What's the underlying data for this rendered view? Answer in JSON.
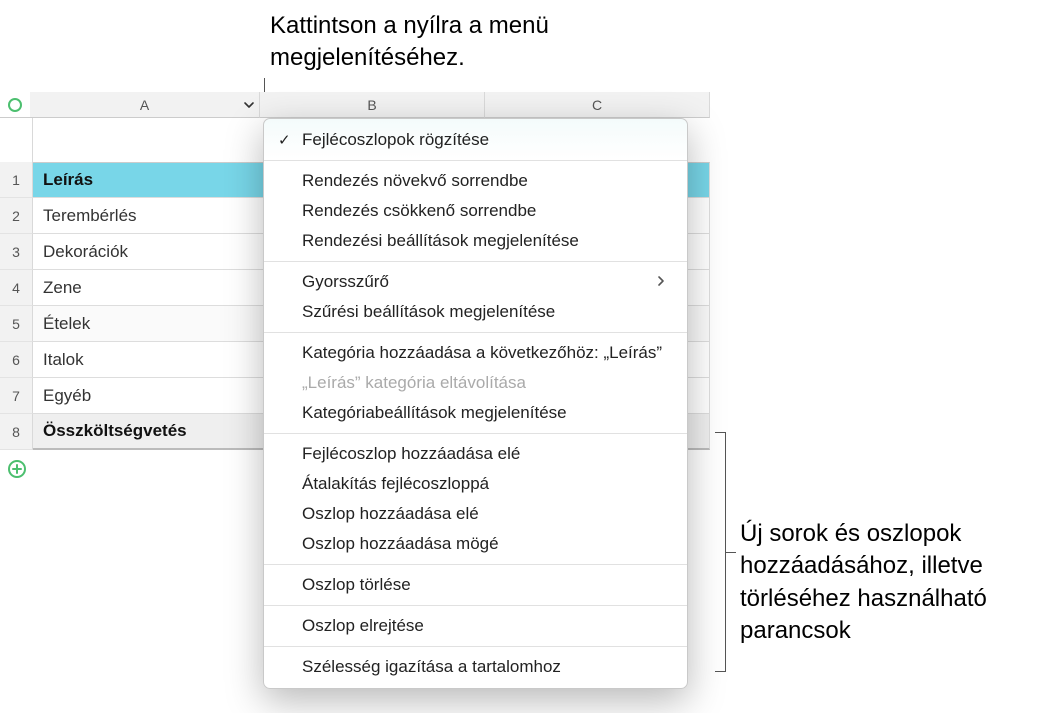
{
  "annotations": {
    "top_line1": "Kattintson a nyílra a menü",
    "top_line2": "megjelenítéséhez.",
    "bottom_line1": "Új sorok és oszlopok",
    "bottom_line2": "hozzáadásához, illetve",
    "bottom_line3": "törléséhez használható",
    "bottom_line4": "parancsok"
  },
  "columns": [
    "A",
    "B",
    "C"
  ],
  "row_numbers": [
    "1",
    "2",
    "3",
    "4",
    "5",
    "6",
    "7",
    "8"
  ],
  "rows": [
    {
      "label": "Leírás",
      "kind": "header"
    },
    {
      "label": "Terembérlés",
      "kind": "normal"
    },
    {
      "label": "Dekorációk",
      "kind": "normal"
    },
    {
      "label": "Zene",
      "kind": "normal"
    },
    {
      "label": "Ételek",
      "kind": "normal"
    },
    {
      "label": "Italok",
      "kind": "normal"
    },
    {
      "label": "Egyéb",
      "kind": "normal"
    },
    {
      "label": "Összköltségvetés",
      "kind": "footer"
    }
  ],
  "menu": {
    "groups": [
      [
        {
          "label": "Fejlécoszlopok rögzítése",
          "checked": true
        }
      ],
      [
        {
          "label": "Rendezés növekvő sorrendbe"
        },
        {
          "label": "Rendezés csökkenő sorrendbe"
        },
        {
          "label": "Rendezési beállítások megjelenítése"
        }
      ],
      [
        {
          "label": "Gyorsszűrő",
          "submenu": true
        },
        {
          "label": "Szűrési beállítások megjelenítése"
        }
      ],
      [
        {
          "label": "Kategória hozzáadása a következőhöz: „Leírás”"
        },
        {
          "label": "„Leírás” kategória eltávolítása",
          "disabled": true
        },
        {
          "label": "Kategóriabeállítások megjelenítése"
        }
      ],
      [
        {
          "label": "Fejlécoszlop hozzáadása elé"
        },
        {
          "label": "Átalakítás fejlécoszloppá"
        },
        {
          "label": "Oszlop hozzáadása elé"
        },
        {
          "label": "Oszlop hozzáadása mögé"
        }
      ],
      [
        {
          "label": "Oszlop törlése"
        }
      ],
      [
        {
          "label": "Oszlop elrejtése"
        }
      ],
      [
        {
          "label": "Szélesség igazítása a tartalomhoz"
        }
      ]
    ]
  }
}
